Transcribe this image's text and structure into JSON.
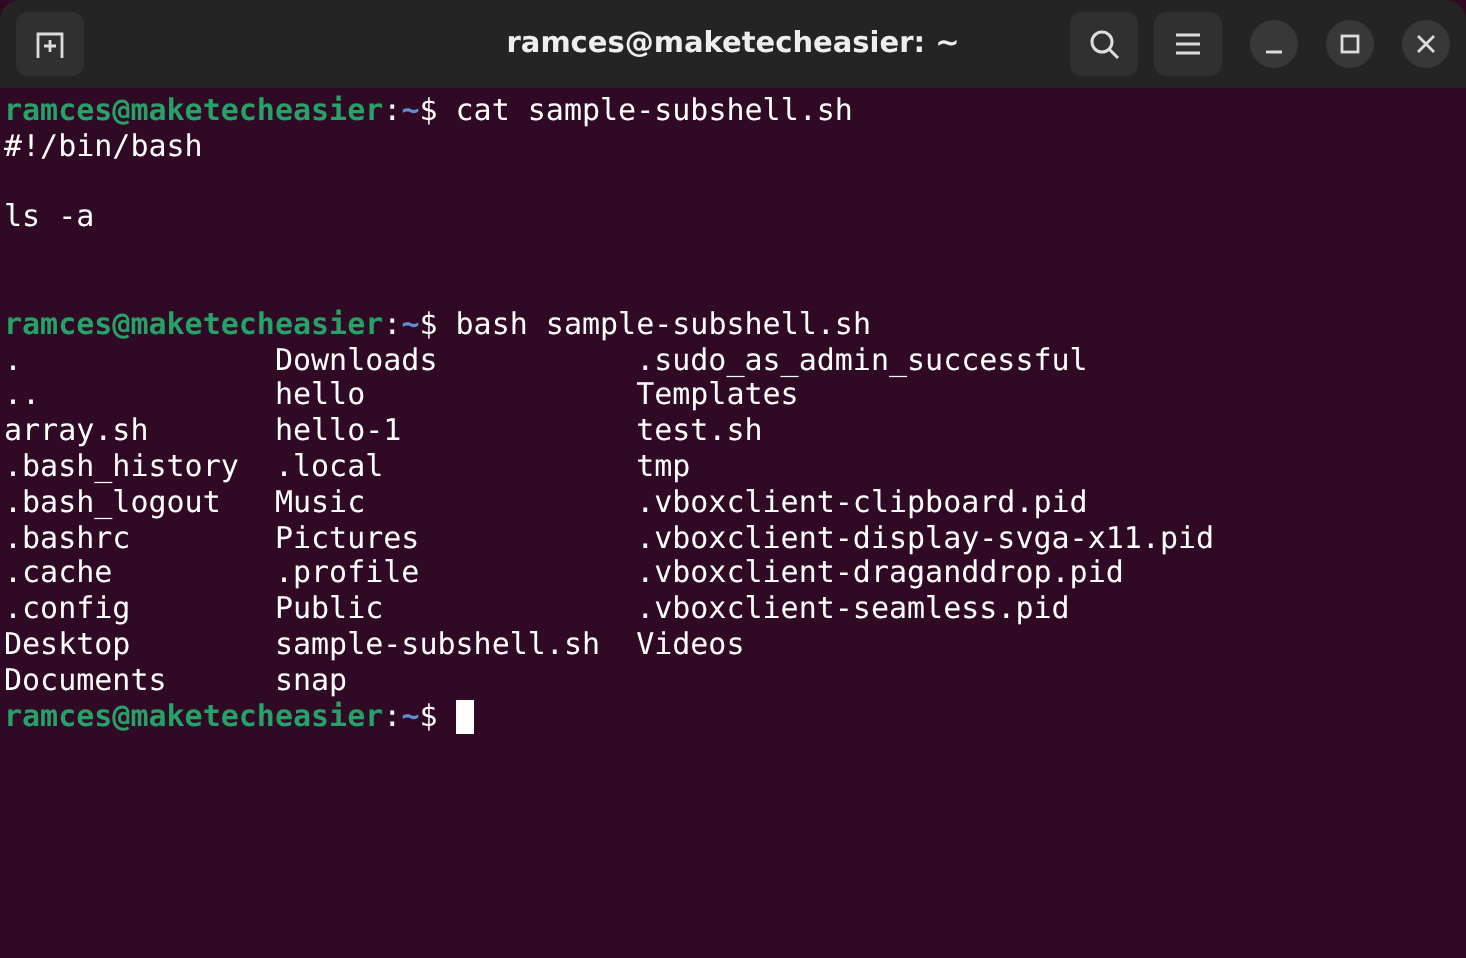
{
  "window": {
    "title": "ramces@maketecheasier: ~"
  },
  "lines": [
    {
      "kind": "prompt",
      "user_host": "ramces@maketecheasier",
      "separator": ":",
      "path": "~",
      "symbol": "$",
      "command": "cat sample-subshell.sh",
      "cursor": false
    },
    {
      "kind": "output",
      "text": "#!/bin/bash"
    },
    {
      "kind": "blank"
    },
    {
      "kind": "output",
      "text": "ls -a"
    },
    {
      "kind": "blank"
    },
    {
      "kind": "blank"
    },
    {
      "kind": "prompt",
      "user_host": "ramces@maketecheasier",
      "separator": ":",
      "path": "~",
      "symbol": "$",
      "command": "bash sample-subshell.sh",
      "cursor": false
    },
    {
      "kind": "columns",
      "cells": [
        ".",
        "Downloads",
        ".sudo_as_admin_successful"
      ]
    },
    {
      "kind": "columns",
      "cells": [
        "..",
        "hello",
        "Templates"
      ]
    },
    {
      "kind": "columns",
      "cells": [
        "array.sh",
        "hello-1",
        "test.sh"
      ]
    },
    {
      "kind": "columns",
      "cells": [
        ".bash_history",
        ".local",
        "tmp"
      ]
    },
    {
      "kind": "columns",
      "cells": [
        ".bash_logout",
        "Music",
        ".vboxclient-clipboard.pid"
      ]
    },
    {
      "kind": "columns",
      "cells": [
        ".bashrc",
        "Pictures",
        ".vboxclient-display-svga-x11.pid"
      ]
    },
    {
      "kind": "columns",
      "cells": [
        ".cache",
        ".profile",
        ".vboxclient-draganddrop.pid"
      ]
    },
    {
      "kind": "columns",
      "cells": [
        ".config",
        "Public",
        ".vboxclient-seamless.pid"
      ]
    },
    {
      "kind": "columns",
      "cells": [
        "Desktop",
        "sample-subshell.sh",
        "Videos"
      ]
    },
    {
      "kind": "columns",
      "cells": [
        "Documents",
        "snap"
      ]
    },
    {
      "kind": "prompt",
      "user_host": "ramces@maketecheasier",
      "separator": ":",
      "path": "~",
      "symbol": "$",
      "cursor": true
    }
  ]
}
